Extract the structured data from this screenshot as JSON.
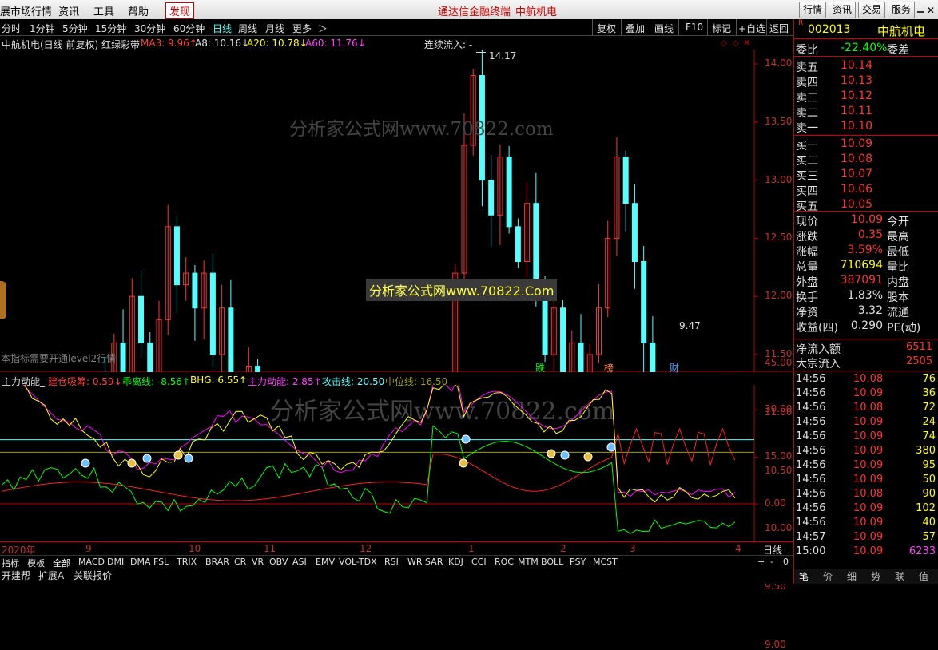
{
  "menu": {
    "items": [
      "展市场行情",
      "资讯",
      "工具",
      "帮助"
    ],
    "discover": "发现",
    "center_title": "通达信金融终端",
    "stock_title": "中航机电",
    "right_buttons": [
      "行情",
      "资讯",
      "交易",
      "服务"
    ]
  },
  "toolbar": {
    "periods": [
      "分时",
      "1分钟",
      "5分钟",
      "15分钟",
      "30分钟",
      "60分钟",
      "日线",
      "周线",
      "月线",
      "更多",
      "＞"
    ],
    "active": "日线",
    "right_buttons": [
      "复权",
      "叠加",
      "画线",
      "F10",
      "标记",
      "+自选",
      "返回"
    ]
  },
  "main_info": {
    "title": "中航机电(日线 前复权) 红绿彩带",
    "ma3": "MA3: 9.96↑",
    "a8": "A8: 10.16↓",
    "a20": "A20: 10.78↓",
    "a60": "A60: 11.76↓",
    "flow": "连续流入: -",
    "high_label": "14.17",
    "low_label": "9.47",
    "level2_note": "本指标需要开通level2行情",
    "watermark1": "分析家公式网www.70822.com",
    "watermark2": "分析家公式网www.70822.Com",
    "markers": [
      "跌",
      "榜",
      "财"
    ]
  },
  "price_axis": [
    "14.00",
    "13.50",
    "13.00",
    "12.50",
    "12.00",
    "11.50",
    "11.00",
    "10.50",
    "10.00",
    "9.50",
    "9.00"
  ],
  "sub_info": {
    "title": "主力动能_",
    "build": "建仓吸筹: 0.59↓",
    "deviation": "乖离线: -8.56↑",
    "bhg": "BHG: 6.55↑",
    "power": "主力动能: 2.85↑",
    "attack": "攻击线: 20.50",
    "midline": "中位线: 16.50",
    "watermark": "分析家公式网www.70822.com"
  },
  "sub_axis": [
    "45.00",
    "30.00",
    "15.00",
    "0.00"
  ],
  "date_axis": {
    "labels": [
      "2020年",
      "9",
      "10",
      "11",
      "12",
      "1",
      "2",
      "3",
      "4"
    ],
    "period": "日线"
  },
  "indicator_tabs": [
    "指标",
    "模板",
    "全部",
    "MACD",
    "DMI",
    "DMA",
    "FSL",
    "TRIX",
    "BRAR",
    "CR",
    "VR",
    "OBV",
    "ASI",
    "EMV",
    "VOL-TDX",
    "RSI",
    "WR",
    "SAR",
    "KDJ",
    "CCI",
    "ROC",
    "MTM",
    "BOLL",
    "PSY",
    "MCST"
  ],
  "indicator_tabs_right": [
    "+",
    "-",
    "0"
  ],
  "bottom_tabs": [
    "开建帮",
    "扩展A",
    "关联报价"
  ],
  "quote": {
    "code": "002013",
    "name": "中航机电",
    "r_mark": "R",
    "weibi_label": "委比",
    "weibi": "-22.40%",
    "weicha_label": "委差",
    "asks": [
      [
        "卖五",
        "10.14"
      ],
      [
        "卖四",
        "10.13"
      ],
      [
        "卖三",
        "10.12"
      ],
      [
        "卖二",
        "10.11"
      ],
      [
        "卖一",
        "10.10"
      ]
    ],
    "bids": [
      [
        "买一",
        "10.09"
      ],
      [
        "买二",
        "10.08"
      ],
      [
        "买三",
        "10.07"
      ],
      [
        "买四",
        "10.06"
      ],
      [
        "买五",
        "10.05"
      ]
    ],
    "stats": [
      [
        "现价",
        "10.09",
        "今开"
      ],
      [
        "涨跌",
        "0.35",
        "最高"
      ],
      [
        "涨幅",
        "3.59%",
        "最低"
      ],
      [
        "总量",
        "710694",
        "量比"
      ],
      [
        "外盘",
        "387091",
        "内盘"
      ],
      [
        "换手",
        "1.83%",
        "股本"
      ],
      [
        "净资",
        "3.32",
        "流通"
      ],
      [
        "收益(四)",
        "0.290",
        "PE(动)"
      ]
    ],
    "net_inflow_label": "净流入额",
    "net_inflow": "6511",
    "big_inflow_label": "大宗流入",
    "big_inflow": "2505",
    "ticks": [
      [
        "14:56",
        "10.08",
        "76"
      ],
      [
        "14:56",
        "10.09",
        "36"
      ],
      [
        "14:56",
        "10.08",
        "72"
      ],
      [
        "14:56",
        "10.09",
        "24"
      ],
      [
        "14:56",
        "10.09",
        "74"
      ],
      [
        "14:56",
        "10.09",
        "380"
      ],
      [
        "14:56",
        "10.09",
        "95"
      ],
      [
        "14:56",
        "10.09",
        "50"
      ],
      [
        "14:56",
        "10.08",
        "90"
      ],
      [
        "14:56",
        "10.09",
        "102"
      ],
      [
        "14:56",
        "10.09",
        "40"
      ],
      [
        "14:57",
        "10.09",
        "57"
      ],
      [
        "15:00",
        "10.09",
        "6233"
      ]
    ],
    "bottom_tabs": [
      "笔",
      "价",
      "细",
      "势",
      "联",
      "值"
    ]
  },
  "colors": {
    "up": "#ff3232",
    "down": "#54ffff",
    "yellow": "#ffff00",
    "magenta": "#ff00ff",
    "green": "#00ff00",
    "grid": "#c00000"
  }
}
